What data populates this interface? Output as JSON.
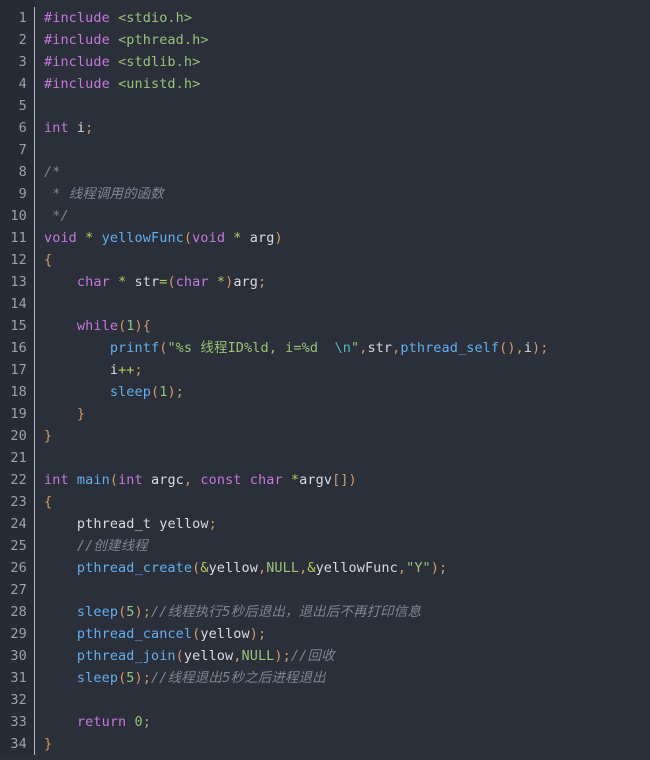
{
  "editor": {
    "language": "c",
    "first_line": 1,
    "last_line": 34,
    "total_lines": 34,
    "colors": {
      "background": "#2b2f3a",
      "gutter_background": "#272b33",
      "gutter_text": "#9aa3b0",
      "separator": "#b9bfc9",
      "default_text": "#d7dae0",
      "keyword": "#c678dd",
      "string": "#98c379",
      "number": "#98c379",
      "function": "#61afef",
      "operator": "#d19a66",
      "operator_alt": "#b5cc5a",
      "escape": "#56b6c2",
      "comment": "#7f8694"
    }
  },
  "gutter": {
    "line_numbers": [
      "1",
      "2",
      "3",
      "4",
      "5",
      "6",
      "7",
      "8",
      "9",
      "10",
      "11",
      "12",
      "13",
      "14",
      "15",
      "16",
      "17",
      "18",
      "19",
      "20",
      "21",
      "22",
      "23",
      "24",
      "25",
      "26",
      "27",
      "28",
      "29",
      "30",
      "31",
      "32",
      "33",
      "34"
    ]
  },
  "code": {
    "lines": [
      {
        "n": 1,
        "text": "#include <stdio.h>"
      },
      {
        "n": 2,
        "text": "#include <pthread.h>"
      },
      {
        "n": 3,
        "text": "#include <stdlib.h>"
      },
      {
        "n": 4,
        "text": "#include <unistd.h>"
      },
      {
        "n": 5,
        "text": ""
      },
      {
        "n": 6,
        "text": "int i;"
      },
      {
        "n": 7,
        "text": ""
      },
      {
        "n": 8,
        "text": "/*"
      },
      {
        "n": 9,
        "text": " * 线程调用的函数"
      },
      {
        "n": 10,
        "text": " */"
      },
      {
        "n": 11,
        "text": "void * yellowFunc(void * arg)"
      },
      {
        "n": 12,
        "text": "{"
      },
      {
        "n": 13,
        "text": "    char * str=(char *)arg;"
      },
      {
        "n": 14,
        "text": ""
      },
      {
        "n": 15,
        "text": "    while(1){"
      },
      {
        "n": 16,
        "text": "        printf(\"%s 线程ID%ld, i=%d  \\n\",str,pthread_self(),i);"
      },
      {
        "n": 17,
        "text": "        i++;"
      },
      {
        "n": 18,
        "text": "        sleep(1);"
      },
      {
        "n": 19,
        "text": "    }"
      },
      {
        "n": 20,
        "text": "}"
      },
      {
        "n": 21,
        "text": ""
      },
      {
        "n": 22,
        "text": "int main(int argc, const char *argv[])"
      },
      {
        "n": 23,
        "text": "{"
      },
      {
        "n": 24,
        "text": "    pthread_t yellow;"
      },
      {
        "n": 25,
        "text": "    //创建线程"
      },
      {
        "n": 26,
        "text": "    pthread_create(&yellow,NULL,&yellowFunc,\"Y\");"
      },
      {
        "n": 27,
        "text": ""
      },
      {
        "n": 28,
        "text": "    sleep(5);//线程执行5秒后退出，退出后不再打印信息"
      },
      {
        "n": 29,
        "text": "    pthread_cancel(yellow);"
      },
      {
        "n": 30,
        "text": "    pthread_join(yellow,NULL);//回收"
      },
      {
        "n": 31,
        "text": "    sleep(5);//线程退出5秒之后进程退出"
      },
      {
        "n": 32,
        "text": ""
      },
      {
        "n": 33,
        "text": "    return 0;"
      },
      {
        "n": 34,
        "text": "}"
      }
    ],
    "tokens": {
      "keywords": [
        "#include",
        "int",
        "void",
        "char",
        "const",
        "return",
        "while"
      ],
      "functions": [
        "yellowFunc",
        "printf",
        "sleep",
        "main",
        "pthread_create",
        "pthread_cancel",
        "pthread_join",
        "pthread_self"
      ],
      "strings": [
        "<stdio.h>",
        "<pthread.h>",
        "<stdlib.h>",
        "<unistd.h>",
        "\"%s 线程ID%ld, i=%d  \\n\"",
        "\"Y\"",
        "NULL"
      ],
      "comments": [
        "/*",
        " * 线程调用的函数",
        " */",
        "//创建线程",
        "//线程执行5秒后退出，退出后不再打印信息",
        "//回收",
        "//线程退出5秒之后进程退出"
      ]
    }
  }
}
